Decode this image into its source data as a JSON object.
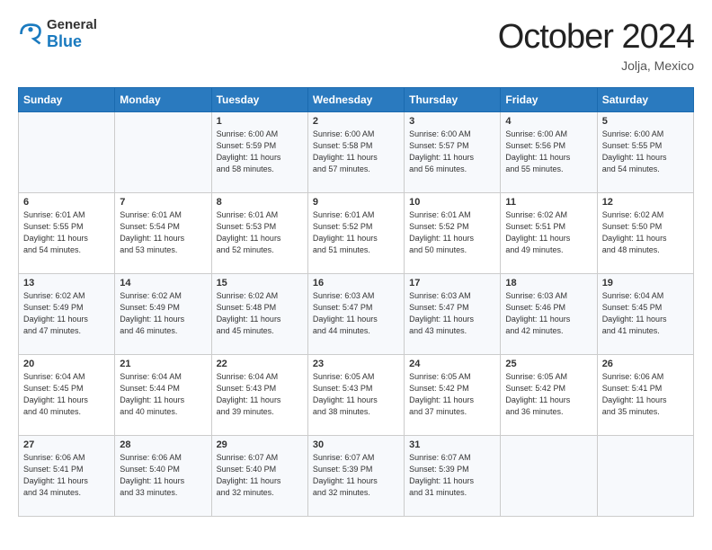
{
  "logo": {
    "general": "General",
    "blue": "Blue"
  },
  "title": "October 2024",
  "location": "Jolja, Mexico",
  "days_of_week": [
    "Sunday",
    "Monday",
    "Tuesday",
    "Wednesday",
    "Thursday",
    "Friday",
    "Saturday"
  ],
  "weeks": [
    [
      {
        "day": "",
        "content": ""
      },
      {
        "day": "",
        "content": ""
      },
      {
        "day": "1",
        "content": "Sunrise: 6:00 AM\nSunset: 5:59 PM\nDaylight: 11 hours\nand 58 minutes."
      },
      {
        "day": "2",
        "content": "Sunrise: 6:00 AM\nSunset: 5:58 PM\nDaylight: 11 hours\nand 57 minutes."
      },
      {
        "day": "3",
        "content": "Sunrise: 6:00 AM\nSunset: 5:57 PM\nDaylight: 11 hours\nand 56 minutes."
      },
      {
        "day": "4",
        "content": "Sunrise: 6:00 AM\nSunset: 5:56 PM\nDaylight: 11 hours\nand 55 minutes."
      },
      {
        "day": "5",
        "content": "Sunrise: 6:00 AM\nSunset: 5:55 PM\nDaylight: 11 hours\nand 54 minutes."
      }
    ],
    [
      {
        "day": "6",
        "content": "Sunrise: 6:01 AM\nSunset: 5:55 PM\nDaylight: 11 hours\nand 54 minutes."
      },
      {
        "day": "7",
        "content": "Sunrise: 6:01 AM\nSunset: 5:54 PM\nDaylight: 11 hours\nand 53 minutes."
      },
      {
        "day": "8",
        "content": "Sunrise: 6:01 AM\nSunset: 5:53 PM\nDaylight: 11 hours\nand 52 minutes."
      },
      {
        "day": "9",
        "content": "Sunrise: 6:01 AM\nSunset: 5:52 PM\nDaylight: 11 hours\nand 51 minutes."
      },
      {
        "day": "10",
        "content": "Sunrise: 6:01 AM\nSunset: 5:52 PM\nDaylight: 11 hours\nand 50 minutes."
      },
      {
        "day": "11",
        "content": "Sunrise: 6:02 AM\nSunset: 5:51 PM\nDaylight: 11 hours\nand 49 minutes."
      },
      {
        "day": "12",
        "content": "Sunrise: 6:02 AM\nSunset: 5:50 PM\nDaylight: 11 hours\nand 48 minutes."
      }
    ],
    [
      {
        "day": "13",
        "content": "Sunrise: 6:02 AM\nSunset: 5:49 PM\nDaylight: 11 hours\nand 47 minutes."
      },
      {
        "day": "14",
        "content": "Sunrise: 6:02 AM\nSunset: 5:49 PM\nDaylight: 11 hours\nand 46 minutes."
      },
      {
        "day": "15",
        "content": "Sunrise: 6:02 AM\nSunset: 5:48 PM\nDaylight: 11 hours\nand 45 minutes."
      },
      {
        "day": "16",
        "content": "Sunrise: 6:03 AM\nSunset: 5:47 PM\nDaylight: 11 hours\nand 44 minutes."
      },
      {
        "day": "17",
        "content": "Sunrise: 6:03 AM\nSunset: 5:47 PM\nDaylight: 11 hours\nand 43 minutes."
      },
      {
        "day": "18",
        "content": "Sunrise: 6:03 AM\nSunset: 5:46 PM\nDaylight: 11 hours\nand 42 minutes."
      },
      {
        "day": "19",
        "content": "Sunrise: 6:04 AM\nSunset: 5:45 PM\nDaylight: 11 hours\nand 41 minutes."
      }
    ],
    [
      {
        "day": "20",
        "content": "Sunrise: 6:04 AM\nSunset: 5:45 PM\nDaylight: 11 hours\nand 40 minutes."
      },
      {
        "day": "21",
        "content": "Sunrise: 6:04 AM\nSunset: 5:44 PM\nDaylight: 11 hours\nand 40 minutes."
      },
      {
        "day": "22",
        "content": "Sunrise: 6:04 AM\nSunset: 5:43 PM\nDaylight: 11 hours\nand 39 minutes."
      },
      {
        "day": "23",
        "content": "Sunrise: 6:05 AM\nSunset: 5:43 PM\nDaylight: 11 hours\nand 38 minutes."
      },
      {
        "day": "24",
        "content": "Sunrise: 6:05 AM\nSunset: 5:42 PM\nDaylight: 11 hours\nand 37 minutes."
      },
      {
        "day": "25",
        "content": "Sunrise: 6:05 AM\nSunset: 5:42 PM\nDaylight: 11 hours\nand 36 minutes."
      },
      {
        "day": "26",
        "content": "Sunrise: 6:06 AM\nSunset: 5:41 PM\nDaylight: 11 hours\nand 35 minutes."
      }
    ],
    [
      {
        "day": "27",
        "content": "Sunrise: 6:06 AM\nSunset: 5:41 PM\nDaylight: 11 hours\nand 34 minutes."
      },
      {
        "day": "28",
        "content": "Sunrise: 6:06 AM\nSunset: 5:40 PM\nDaylight: 11 hours\nand 33 minutes."
      },
      {
        "day": "29",
        "content": "Sunrise: 6:07 AM\nSunset: 5:40 PM\nDaylight: 11 hours\nand 32 minutes."
      },
      {
        "day": "30",
        "content": "Sunrise: 6:07 AM\nSunset: 5:39 PM\nDaylight: 11 hours\nand 32 minutes."
      },
      {
        "day": "31",
        "content": "Sunrise: 6:07 AM\nSunset: 5:39 PM\nDaylight: 11 hours\nand 31 minutes."
      },
      {
        "day": "",
        "content": ""
      },
      {
        "day": "",
        "content": ""
      }
    ]
  ]
}
